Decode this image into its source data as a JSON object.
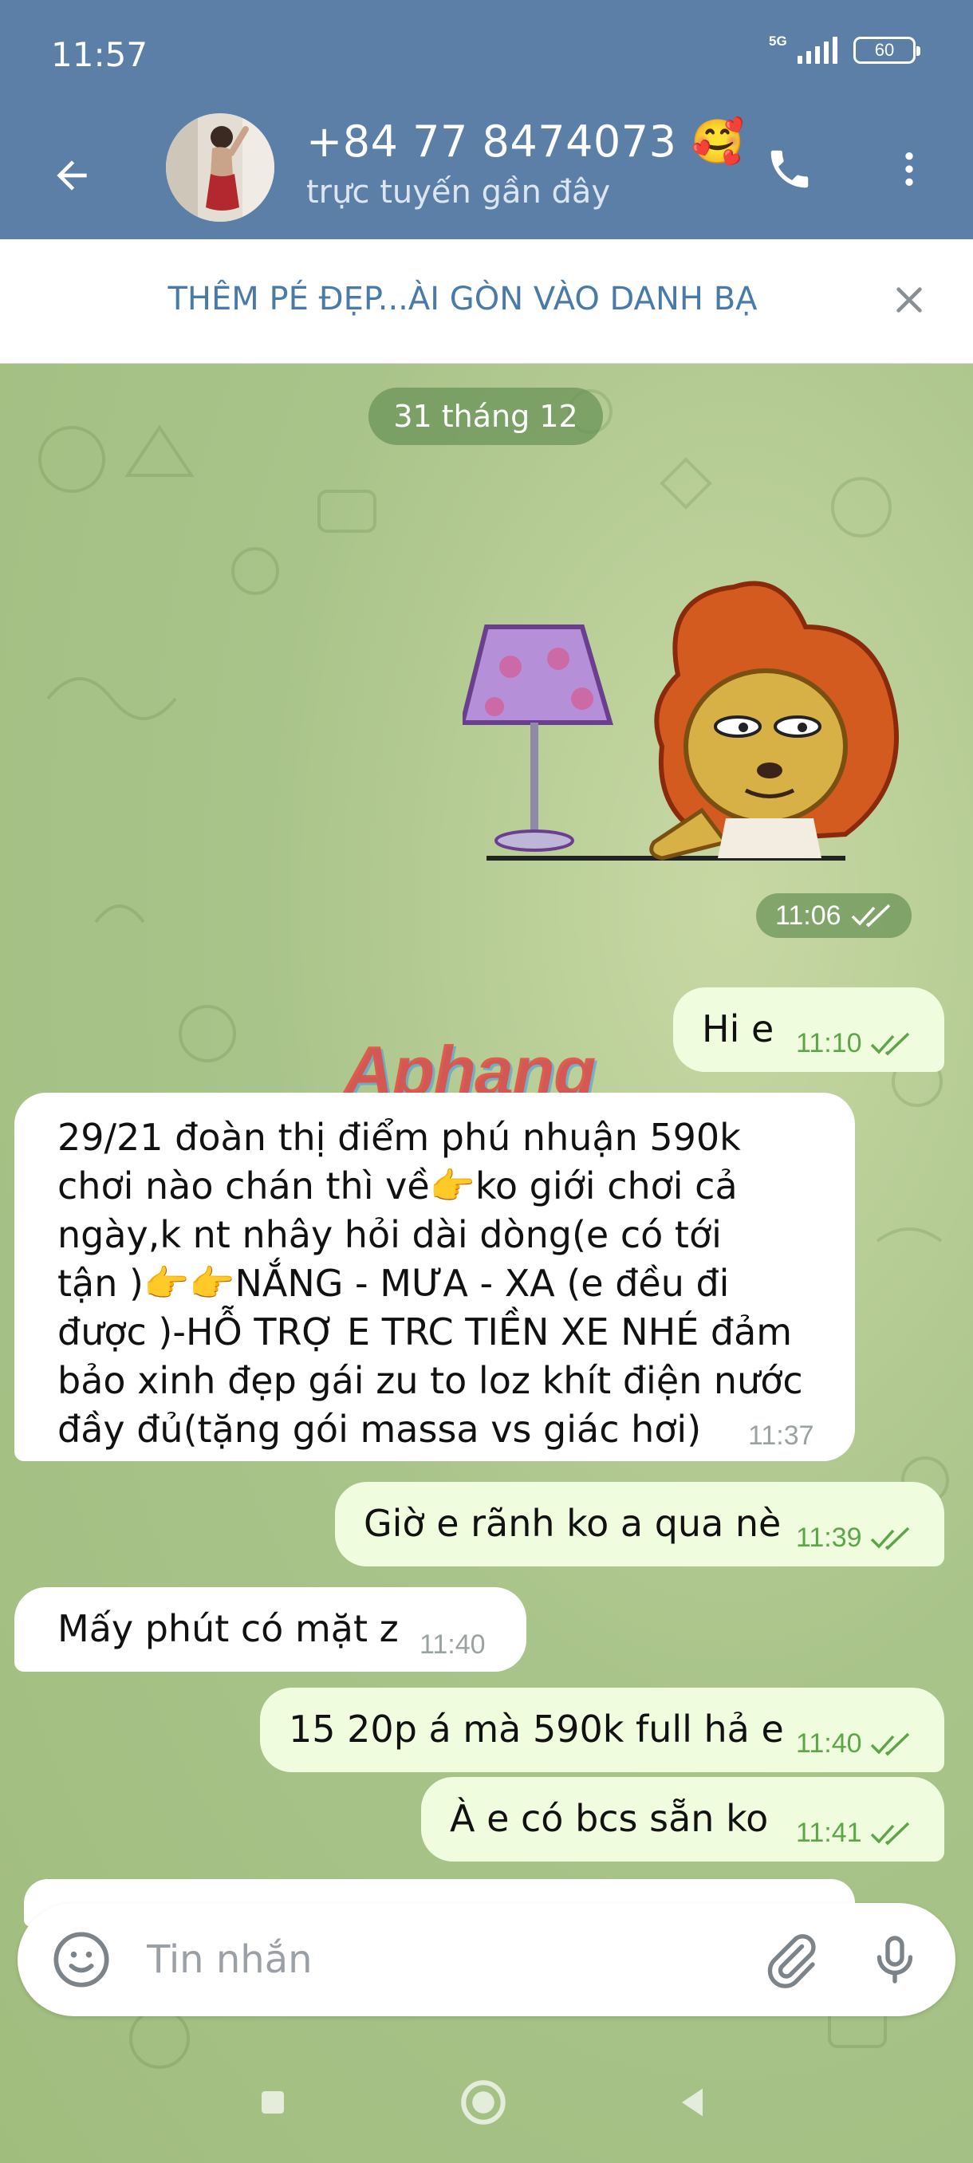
{
  "status_bar": {
    "time": "11:57",
    "network": "5G",
    "battery": "60"
  },
  "header": {
    "contact_name": "+84 77 8474073",
    "contact_emoji": "🥰",
    "contact_status": "trực tuyến gần đây"
  },
  "add_contact_banner": {
    "label": "THÊM PÉ ĐẸP...ÀI GÒN VÀO DANH BẠ"
  },
  "chat": {
    "date_separator": "31 tháng 12",
    "sticker_time": "11:06",
    "watermark": "Aphang",
    "messages": [
      {
        "direction": "out",
        "text": "Hi e",
        "time": "11:10"
      },
      {
        "direction": "in",
        "lines": [
          "29/21 đoàn thị điểm phú nhuận 590k",
          "chơi nào chán thì về👉ko giới chơi cả",
          "ngày,k nt nhây hỏi dài dòng(e có tới",
          "tận )👉👉NẮNG - MƯA - XA (e đều đi",
          "được )-HỖ TRỢ E TRC TIỀN XE NHÉ  đảm",
          "bảo xinh đẹp gái zu to loz khít điện nước",
          "đầy đủ(tặng gói massa vs giác hơi)"
        ],
        "time": "11:37"
      },
      {
        "direction": "out",
        "text": "Giờ e rãnh ko a qua nè",
        "time": "11:39"
      },
      {
        "direction": "in",
        "text": "Mấy phút có mặt z",
        "time": "11:40"
      },
      {
        "direction": "out",
        "text": "15 20p á mà 590k full hả e",
        "time": "11:40"
      },
      {
        "direction": "out",
        "text": "À e có bcs sẵn ko",
        "time": "11:41"
      }
    ]
  },
  "composer": {
    "placeholder": "Tin nhắn"
  },
  "colors": {
    "header": "#5b7fa6",
    "outgoing_bubble": "#effdde",
    "incoming_bubble": "#ffffff",
    "read_check": "#5ea54a",
    "banner_text": "#4a7aa8"
  },
  "icons": [
    "back-arrow-icon",
    "phone-icon",
    "more-vertical-icon",
    "close-icon",
    "double-check-icon",
    "emoji-icon",
    "attach-icon",
    "mic-icon",
    "nav-recents-icon",
    "nav-home-icon",
    "nav-back-icon"
  ]
}
